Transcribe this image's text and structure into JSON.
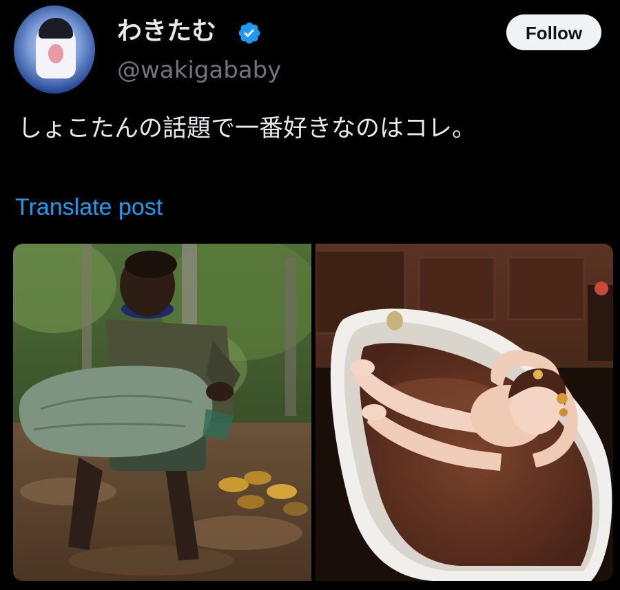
{
  "user": {
    "display_name": "わきたむ",
    "handle": "@wakigababy",
    "verified": true,
    "avatar_icon": "ghost-girl-avatar-icon",
    "verified_icon": "verified-badge-icon"
  },
  "follow_button": {
    "label": "Follow"
  },
  "post": {
    "text": "しょこたんの話題で一番好きなのはコレ。",
    "translate_label": "Translate post"
  },
  "media": {
    "images": [
      {
        "name": "boy-carrying-cocoa-sack-photo"
      },
      {
        "name": "woman-in-chocolate-bath-photo"
      }
    ]
  },
  "colors": {
    "background": "#000000",
    "text_primary": "#e7e9ea",
    "text_secondary": "#71767b",
    "link": "#1d9bf0",
    "verified": "#1d9bf0",
    "button_bg": "#eff3f4"
  }
}
